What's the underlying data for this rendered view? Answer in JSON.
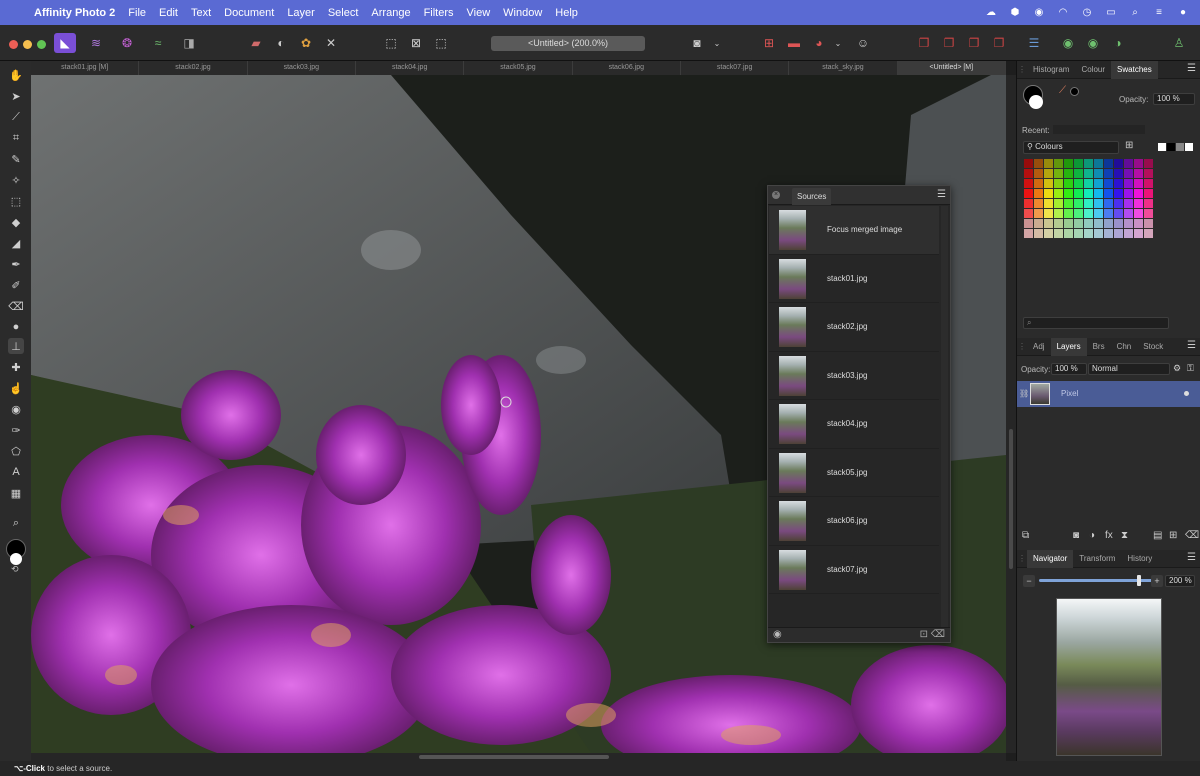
{
  "menubar": {
    "app": "Affinity Photo 2",
    "items": [
      "File",
      "Edit",
      "Text",
      "Document",
      "Layer",
      "Select",
      "Arrange",
      "Filters",
      "View",
      "Window",
      "Help"
    ]
  },
  "document": {
    "title": "<Untitled> (200.0%)",
    "tabs": [
      "stack01.jpg [M]",
      "stack02.jpg",
      "stack03.jpg",
      "stack04.jpg",
      "stack05.jpg",
      "stack06.jpg",
      "stack07.jpg",
      "stack_sky.jpg",
      "<Untitled> [M]"
    ],
    "active_tab": 8
  },
  "sources_panel": {
    "tab": "Sources",
    "items": [
      "Focus merged image",
      "stack01.jpg",
      "stack02.jpg",
      "stack03.jpg",
      "stack04.jpg",
      "stack05.jpg",
      "stack06.jpg",
      "stack07.jpg"
    ]
  },
  "colour_panel": {
    "tabs": [
      "Histogram",
      "Colour",
      "Swatches"
    ],
    "active": "Swatches",
    "opacity_label": "Opacity:",
    "opacity_value": "100 %",
    "recent_label": "Recent:",
    "palette": "Colours"
  },
  "layers_panel": {
    "tabs": [
      "Adj",
      "Layers",
      "Brs",
      "Chn",
      "Stock"
    ],
    "active": "Layers",
    "opacity_label": "Opacity:",
    "opacity_value": "100 %",
    "blend_mode": "Normal",
    "layers": [
      {
        "name": "Pixel"
      }
    ]
  },
  "navigator_panel": {
    "tabs": [
      "Navigator",
      "Transform",
      "History"
    ],
    "active": "Navigator",
    "zoom": "200 %",
    "zoom_level": 0.85
  },
  "status": {
    "key": "⌥-Click",
    "text": " to select a source."
  }
}
